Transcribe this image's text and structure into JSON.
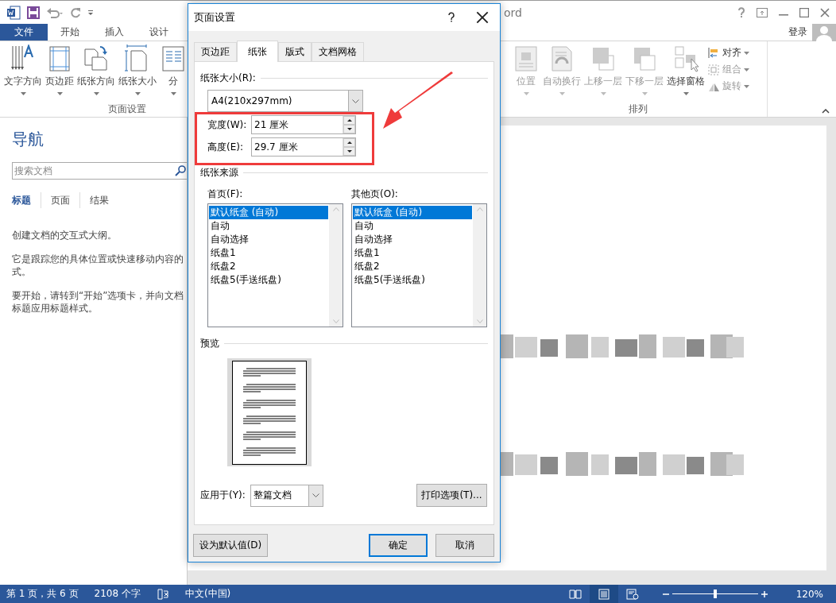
{
  "title_bar": {
    "title_fragment": "ord"
  },
  "ribbon_tabs": [
    {
      "label": "文件",
      "kind": "file"
    },
    {
      "label": "开始",
      "kind": "tab"
    },
    {
      "label": "插入",
      "kind": "tab"
    },
    {
      "label": "设计",
      "kind": "tab"
    }
  ],
  "account": {
    "label": "登录"
  },
  "ribbon_groups": [
    {
      "label": "页面设置",
      "buttons": [
        {
          "label": "文字方向",
          "disabled": false
        },
        {
          "label": "页边距",
          "disabled": false
        },
        {
          "label": "纸张方向",
          "disabled": false
        },
        {
          "label": "纸张大小",
          "disabled": false
        },
        {
          "label": "分",
          "disabled": false
        }
      ]
    },
    {
      "label": "排列",
      "buttons": [
        {
          "label": "位置",
          "disabled": true
        },
        {
          "label": "自动换行",
          "disabled": true
        },
        {
          "label": "上移一层",
          "disabled": true
        },
        {
          "label": "下移一层",
          "disabled": true
        },
        {
          "label": "选择窗格",
          "disabled": false
        }
      ],
      "small_buttons": [
        {
          "label": "对齐",
          "disabled": false
        },
        {
          "label": "组合",
          "disabled": true
        },
        {
          "label": "旋转",
          "disabled": true
        }
      ]
    }
  ],
  "navigation": {
    "title": "导航",
    "search": {
      "placeholder": "搜索文档"
    },
    "tabs": [
      {
        "label": "标题",
        "selected": true
      },
      {
        "label": "页面",
        "selected": false
      },
      {
        "label": "结果",
        "selected": false
      }
    ],
    "paragraphs": [
      [
        "创建文档的交互式大纲。"
      ],
      [
        "它是跟踪您的具体位置或快速移动内容的",
        "式。"
      ],
      [
        "要开始，请转到“开始”选项卡，并向文档",
        "标题应用标题样式。"
      ]
    ]
  },
  "dialog": {
    "title": "页面设置",
    "tabs": [
      {
        "label": "页边距",
        "selected": false
      },
      {
        "label": "纸张",
        "selected": true
      },
      {
        "label": "版式",
        "selected": false
      },
      {
        "label": "文档网格",
        "selected": false
      }
    ],
    "paper_size": {
      "section": "纸张大小(R):",
      "value": "A4(210x297mm)"
    },
    "width": {
      "label": "宽度(W):",
      "value": "21 厘米"
    },
    "height": {
      "label": "高度(E):",
      "value": "29.7 厘米"
    },
    "paper_source": {
      "section": "纸张来源",
      "lists": [
        {
          "label": "首页(F):",
          "items": [
            {
              "label": "默认纸盒 (自动)",
              "selected": true
            },
            {
              "label": "自动",
              "selected": false
            },
            {
              "label": "自动选择",
              "selected": false
            },
            {
              "label": "纸盘1",
              "selected": false
            },
            {
              "label": "纸盘2",
              "selected": false
            },
            {
              "label": "纸盘5(手送纸盘)",
              "selected": false
            }
          ]
        },
        {
          "label": "其他页(O):",
          "items": [
            {
              "label": "默认纸盒 (自动)",
              "selected": true
            },
            {
              "label": "自动",
              "selected": false
            },
            {
              "label": "自动选择",
              "selected": false
            },
            {
              "label": "纸盘1",
              "selected": false
            },
            {
              "label": "纸盘2",
              "selected": false
            },
            {
              "label": "纸盘5(手送纸盘)",
              "selected": false
            }
          ]
        }
      ]
    },
    "preview": {
      "section": "预览"
    },
    "apply_to": {
      "label": "应用于(Y):",
      "value": "整篇文档"
    },
    "print_options": "打印选项(T)...",
    "buttons": [
      {
        "label": "设为默认值(D)",
        "kind": "default"
      },
      {
        "label": "确定",
        "kind": "primary"
      },
      {
        "label": "取消",
        "kind": "cancel"
      }
    ]
  },
  "status_bar": {
    "page": "第 1 页，共 6 页",
    "words": "2108 个字",
    "language": "中文(中国)",
    "views": [
      {
        "kind": "read",
        "selected": false
      },
      {
        "kind": "print",
        "selected": true
      },
      {
        "kind": "web",
        "selected": false
      }
    ],
    "zoom_slider": {
      "level": 0.5
    },
    "zoom": "120%"
  }
}
